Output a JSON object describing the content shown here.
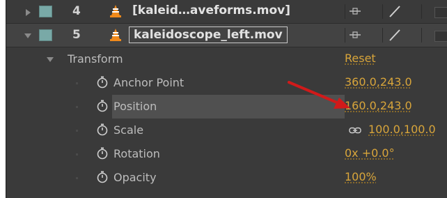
{
  "layers": [
    {
      "number": "4",
      "name": "[kaleid…aveforms.mov]"
    },
    {
      "number": "5",
      "name": "kaleidoscope_left.mov"
    }
  ],
  "transform": {
    "label": "Transform",
    "reset_label": "Reset"
  },
  "properties": [
    {
      "name": "Anchor Point",
      "value": "360.0,243.0"
    },
    {
      "name": "Position",
      "value": "160.0,243.0"
    },
    {
      "name": "Scale",
      "value": "100.0,100.0"
    },
    {
      "name": "Rotation",
      "value": "0x +0.0°"
    },
    {
      "name": "Opacity",
      "value": "100%"
    }
  ],
  "colors": {
    "accent_value": "#d8a53a",
    "layer_label": "#79a9a7",
    "annotation_arrow": "#d11a1a"
  },
  "icons": {
    "video_layer": "vlc-cone-icon",
    "stopwatch": "stopwatch-icon",
    "constrain_proportions": "chain-link-icon"
  }
}
